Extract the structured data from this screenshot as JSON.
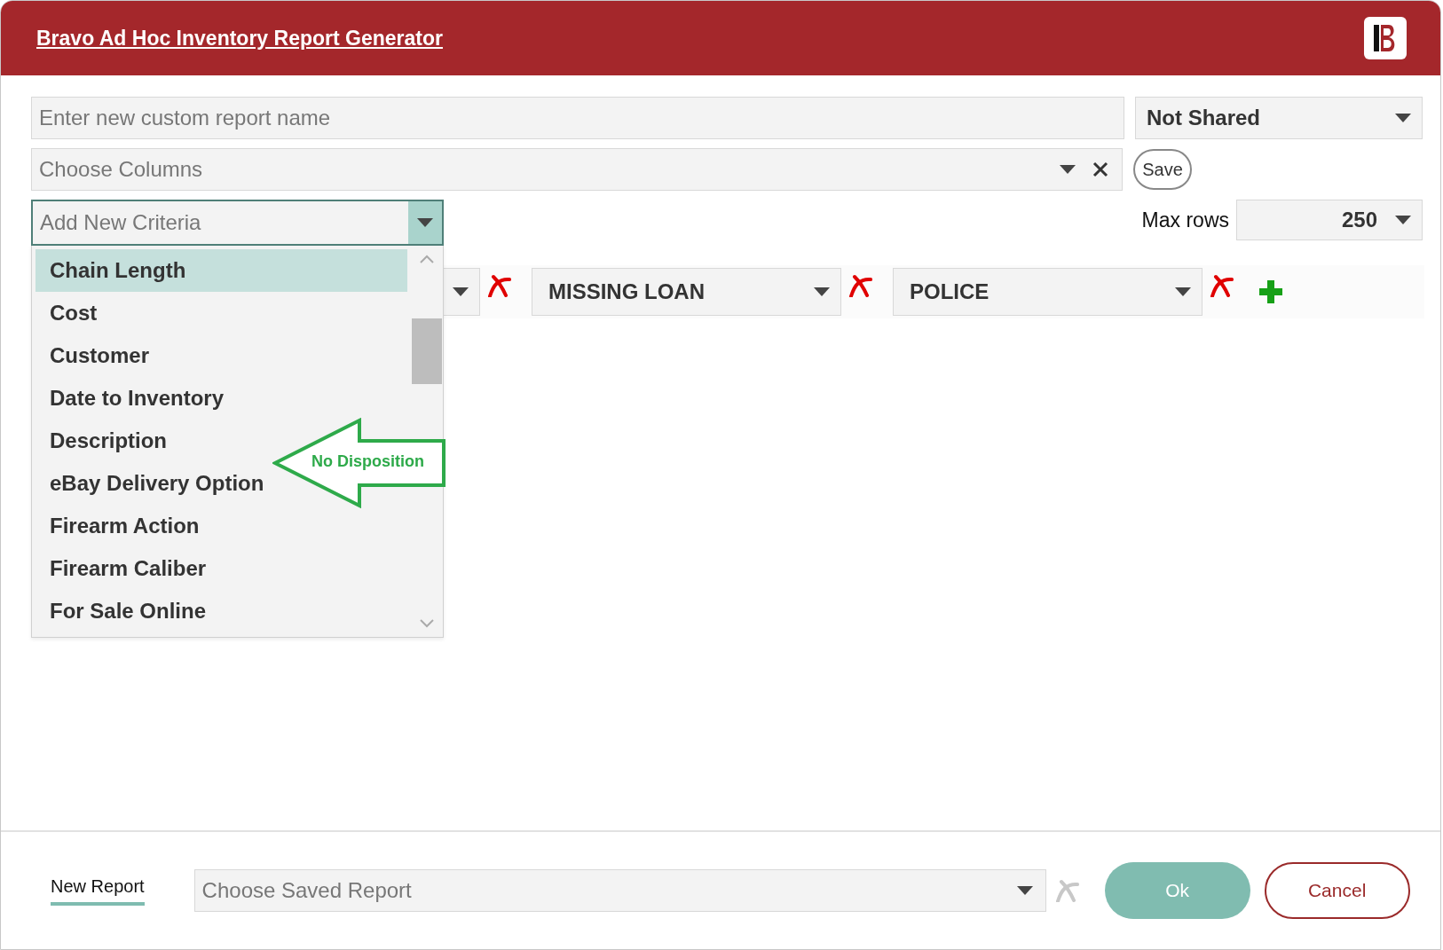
{
  "window": {
    "title": "Bravo Ad Hoc Inventory Report Generator"
  },
  "report_name": {
    "placeholder": "Enter new custom report name"
  },
  "sharing": {
    "value": "Not Shared"
  },
  "columns": {
    "placeholder": "Choose Columns"
  },
  "save_button": "Save",
  "criteria_picker": {
    "placeholder": "Add New Criteria",
    "expanded": true,
    "options": [
      {
        "label": "Chain Length",
        "selected": true
      },
      {
        "label": "Cost",
        "selected": false
      },
      {
        "label": "Customer",
        "selected": false
      },
      {
        "label": "Date to Inventory",
        "selected": false
      },
      {
        "label": "Description",
        "selected": false
      },
      {
        "label": "eBay Delivery Option",
        "selected": false
      },
      {
        "label": "Firearm Action",
        "selected": false
      },
      {
        "label": "Firearm Caliber",
        "selected": false
      },
      {
        "label": "For Sale Online",
        "selected": false
      }
    ]
  },
  "max_rows": {
    "label": "Max rows",
    "value": "250"
  },
  "criteria": [
    {
      "removable": true
    },
    {
      "value": "MISSING LOAN",
      "removable": true
    },
    {
      "value": "POLICE",
      "removable": true
    }
  ],
  "callout": {
    "text": "No Disposition"
  },
  "footer": {
    "tab": {
      "label": "New Report",
      "selected": true
    },
    "saved_report": {
      "placeholder": "Choose Saved Report"
    },
    "clear_disabled": true,
    "buttons": [
      {
        "label": "Ok",
        "kind": "primary"
      },
      {
        "label": "Cancel",
        "kind": "secondary"
      }
    ]
  }
}
